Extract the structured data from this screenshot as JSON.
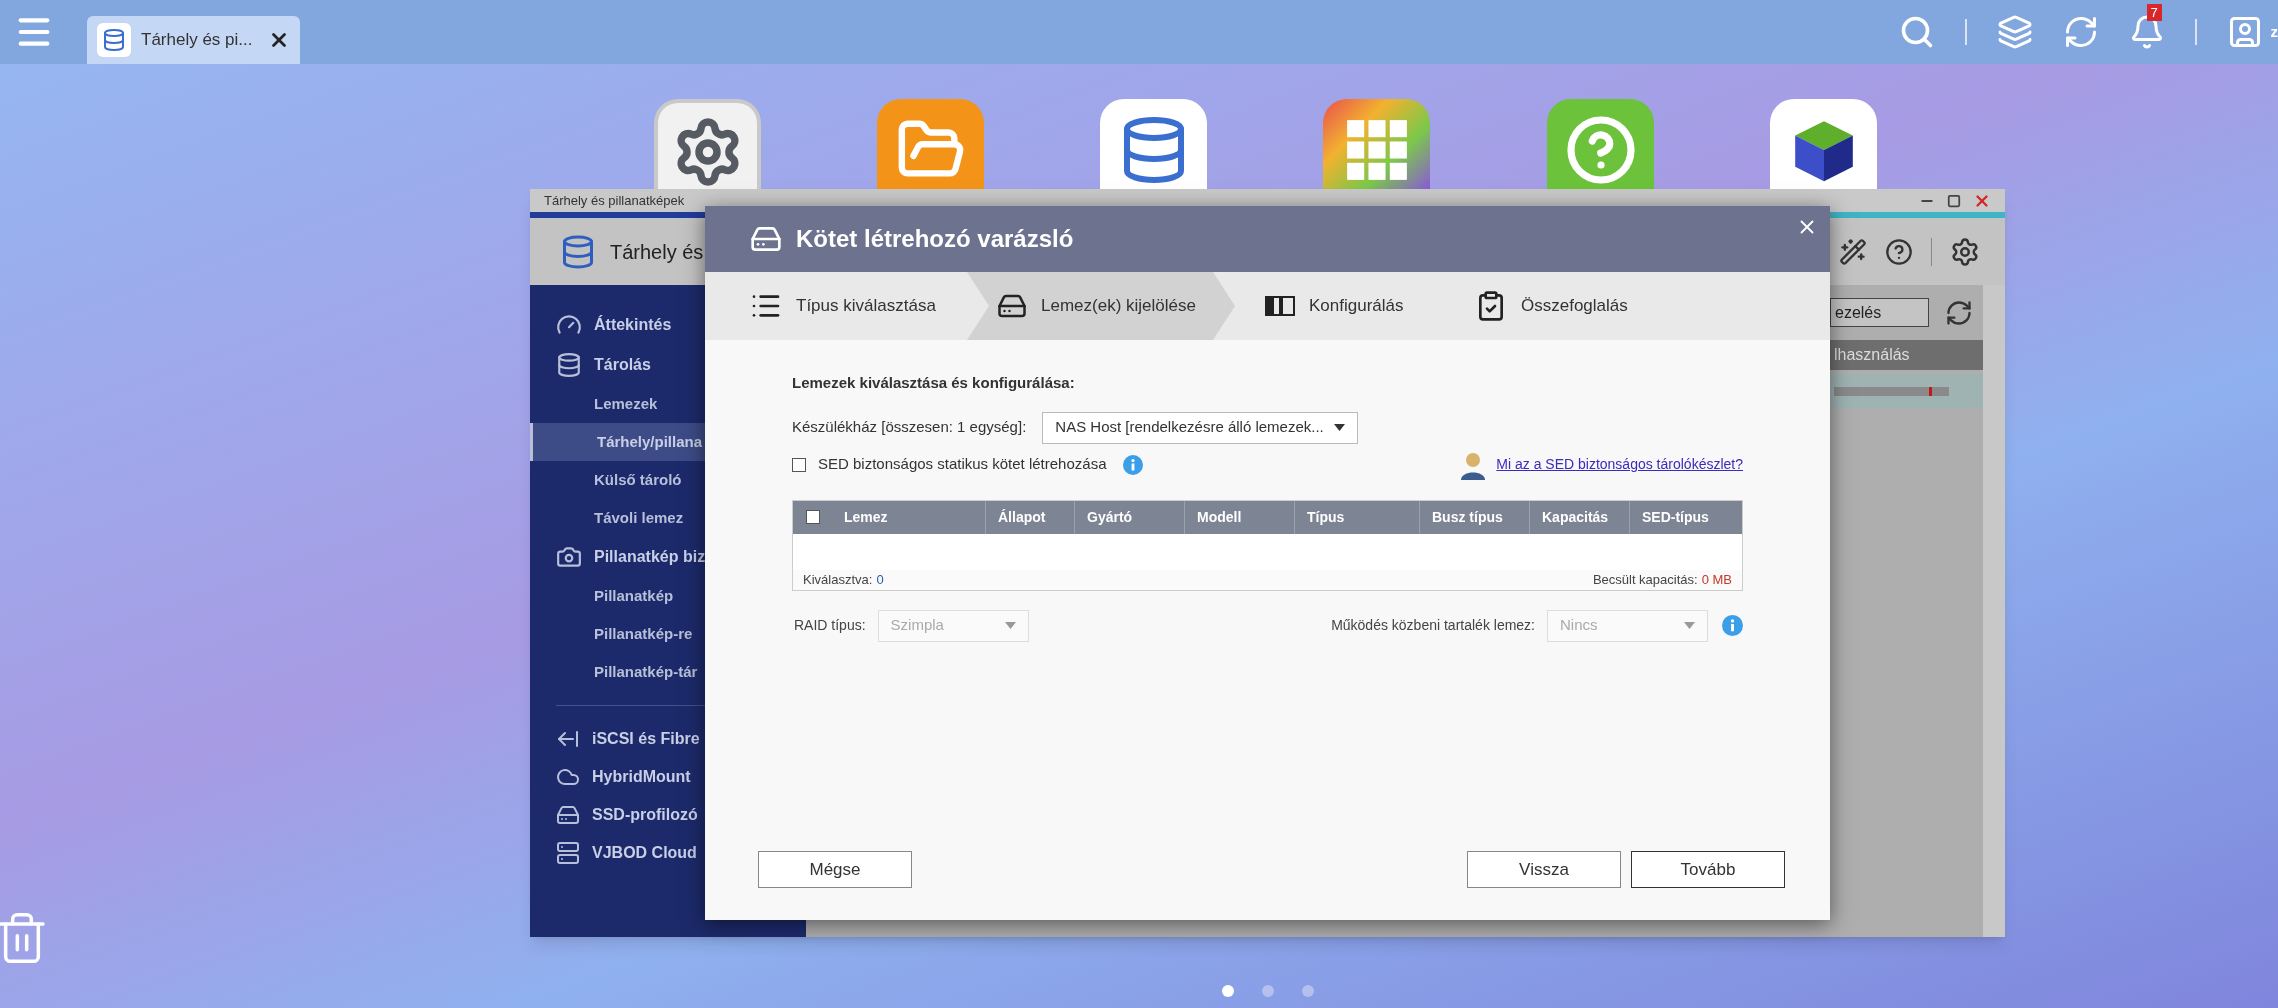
{
  "top_bar": {
    "tab": {
      "title": "Tárhely és pi...",
      "selected": true
    },
    "notifications": {
      "count": "7"
    },
    "user": {
      "name": "z"
    }
  },
  "background_window": {
    "title": "Tárhely és pillanatképek",
    "app_title": "Tárhely és",
    "sidebar": [
      {
        "label": "Áttekintés",
        "selected": false
      },
      {
        "label": "Tárolás",
        "selected": false,
        "children": [
          {
            "label": "Lemezek",
            "selected": false
          },
          {
            "label": "Tárhely/pillana",
            "selected": true
          },
          {
            "label": "Külső tároló",
            "selected": false
          },
          {
            "label": "Távoli lemez",
            "selected": false
          }
        ]
      },
      {
        "label": "Pillanatkép biz",
        "selected": false,
        "children": [
          {
            "label": "Pillanatkép",
            "selected": false
          },
          {
            "label": "Pillanatkép-re",
            "selected": false
          },
          {
            "label": "Pillanatkép-tár",
            "selected": false
          }
        ]
      }
    ],
    "tools": [
      {
        "label": "iSCSI és Fibre"
      },
      {
        "label": "HybridMount"
      },
      {
        "label": "SSD-profilozó"
      },
      {
        "label": "VJBOD Cloud"
      }
    ],
    "search_value": "ezelés",
    "column_header": "lhasználás"
  },
  "wizard": {
    "title": "Kötet létrehozó varázsló",
    "steps": [
      {
        "label": "Típus kiválasztása",
        "selected": false
      },
      {
        "label": "Lemez(ek) kijelölése",
        "selected": true
      },
      {
        "label": "Konfigurálás",
        "selected": false
      },
      {
        "label": "Összefoglalás",
        "selected": false
      }
    ],
    "heading": "Lemezek kiválasztása és konfigurálása:",
    "enclosure": {
      "label": "Készülékház [összesen: 1 egység]:",
      "value": "NAS Host [rendelkezésre álló lemezek..."
    },
    "sed_option": {
      "label": "SED biztonságos statikus kötet létrehozása",
      "checked": false
    },
    "help_link": "Mi az a SED biztonságos tárolókészlet?",
    "disk_table": {
      "select_all_checked": false,
      "columns": [
        "Lemez",
        "Állapot",
        "Gyártó",
        "Modell",
        "Típus",
        "Busz típus",
        "Kapacitás",
        "SED-típus"
      ],
      "selected_label": "Kiválasztva:",
      "selected_count": "0",
      "capacity_label": "Becsült kapacitás:",
      "capacity_value": "0 MB"
    },
    "raid_type": {
      "label": "RAID típus:",
      "value": "Szimpla",
      "disabled": true
    },
    "hot_spare": {
      "label": "Működés közbeni tartalék lemez:",
      "value": "Nincs",
      "disabled": true
    },
    "buttons": [
      {
        "label": "Mégse",
        "kind": "cancel"
      },
      {
        "label": "Vissza",
        "kind": "secondary"
      },
      {
        "label": "Tovább",
        "kind": "primary"
      }
    ]
  },
  "page_dots": [
    {
      "selected": true
    },
    {
      "selected": false
    },
    {
      "selected": false
    }
  ]
}
